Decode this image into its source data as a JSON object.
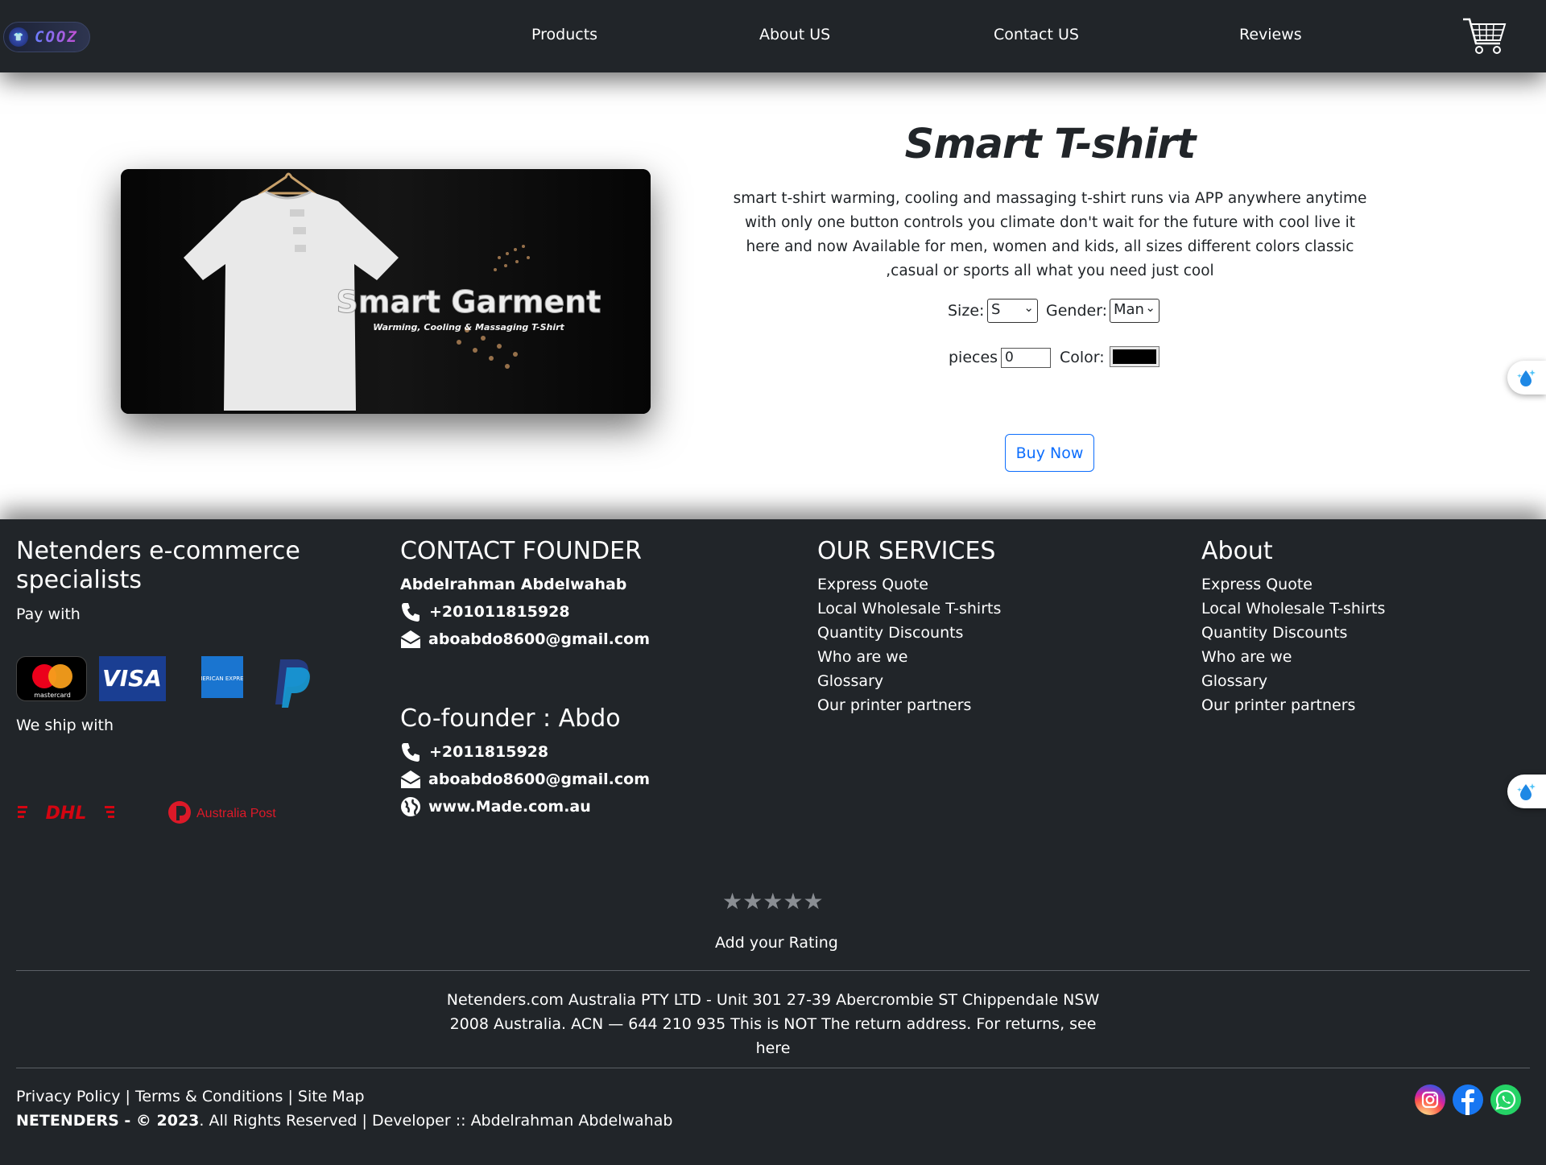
{
  "nav": {
    "logo_text": "COOZ",
    "links": [
      "Products",
      "About US",
      "Contact US",
      "Reviews"
    ]
  },
  "product": {
    "title": "Smart T-shirt",
    "description": "smart t-shirt warming, cooling and massaging t-shirt runs via APP anywhere anytime with only one button controls you climate don't wait for the future with cool live it here and now Available for men, women and kids, all sizes different colors classic ,casual or sports all what you need just cool",
    "image_title": "Smart Garment",
    "image_subtitle": "Warming, Cooling & Massaging T-Shirt",
    "size_label": "Size:",
    "size_value": "S",
    "gender_label": "Gender:",
    "gender_value": "Man",
    "pieces_label": "pieces",
    "pieces_value": "0",
    "color_label": "Color:",
    "color_value": "#000000",
    "buy_label": "Buy Now"
  },
  "footer": {
    "brand_heading": "Netenders e-commerce specialists",
    "pay_with": "Pay with",
    "ship_with": "We ship with",
    "payment_methods": [
      "mastercard",
      "VISA",
      "AMERICAN EXPRESS",
      "PayPal"
    ],
    "shipping": [
      "DHL",
      "Australia Post"
    ],
    "contact_heading": "CONTACT FOUNDER",
    "founder_name": "Abdelrahman Abdelwahab",
    "founder_phone": "+201011815928",
    "founder_email": "aboabdo8600@gmail.com",
    "cofounder_heading": "Co-founder : Abdo",
    "cofounder_phone": "+2011815928",
    "cofounder_email": "aboabdo8600@gmail.com",
    "cofounder_web": "www.Made.com.au",
    "services_heading": "OUR SERVICES",
    "services": [
      "Express Quote",
      "Local Wholesale T-shirts",
      "Quantity Discounts",
      "Who are we",
      "Glossary",
      "Our printer partners"
    ],
    "about_heading": "About",
    "about": [
      "Express Quote",
      "Local Wholesale T-shirts",
      "Quantity Discounts",
      "Who are we",
      "Glossary",
      "Our printer partners"
    ],
    "rating_label": "Add your Rating",
    "rating_value": 0,
    "rating_max": 5,
    "address_line1": "Netenders.com Australia PTY LTD - Unit 301 27-39 Abercrombie ST Chippendale NSW",
    "address_line2": "2008 Australia. ACN — 644 210 935 This is NOT The return address. For returns, see here",
    "privacy": "Privacy Policy",
    "terms": "Terms & Conditions",
    "sitemap": "Site Map",
    "separator": "|",
    "copyright_bold": "NETENDERS - © 2023",
    "copyright_rest": ". All Rights Reserved | Developer :: Abdelrahman Abdelwahab"
  },
  "colors": {
    "nav_bg": "#212529",
    "footer_bg": "#212529",
    "accent": "#0d6efd"
  }
}
